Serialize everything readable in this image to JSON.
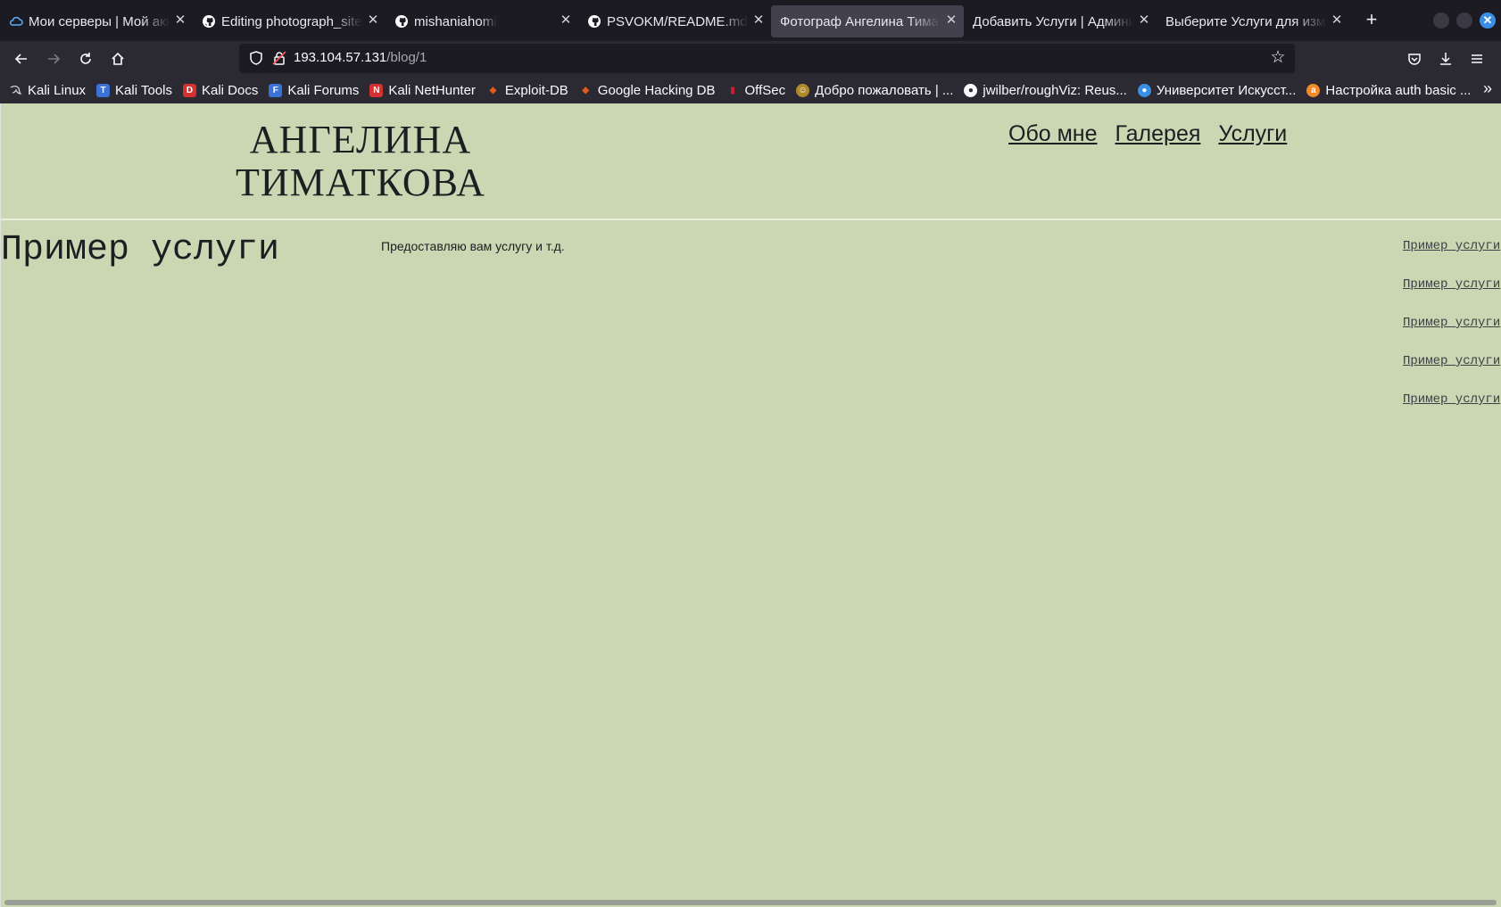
{
  "browser": {
    "tabs": [
      {
        "title": "Мои серверы | Мой аккаунт",
        "icon": "cloud-icon",
        "active": false
      },
      {
        "title": "Editing photograph_site/",
        "icon": "github-icon",
        "active": false
      },
      {
        "title": "mishaniahomi",
        "icon": "github-icon",
        "active": false
      },
      {
        "title": "PSVOKM/README.md at",
        "icon": "github-icon",
        "active": false
      },
      {
        "title": "Фотограф Ангелина Тиматкова",
        "icon": "",
        "active": true
      },
      {
        "title": "Добавить Услуги | Администрирование",
        "icon": "",
        "active": false
      },
      {
        "title": "Выберите Услуги для изменения",
        "icon": "",
        "active": false
      }
    ],
    "url": {
      "host": "193.104.57.131",
      "path": "/blog/1"
    },
    "bookmarks": [
      {
        "label": "Kali Linux",
        "icon": "kali-dragon-icon",
        "color": "#2a2a2a"
      },
      {
        "label": "Kali Tools",
        "icon": "kali-tools-icon",
        "color": "#3a72d8"
      },
      {
        "label": "Kali Docs",
        "icon": "kali-docs-icon",
        "color": "#d63131"
      },
      {
        "label": "Kali Forums",
        "icon": "kali-forums-icon",
        "color": "#3a72d8"
      },
      {
        "label": "Kali NetHunter",
        "icon": "nethunter-icon",
        "color": "#d63131"
      },
      {
        "label": "Exploit-DB",
        "icon": "exploit-db-icon",
        "color": "#e25b1a"
      },
      {
        "label": "Google Hacking DB",
        "icon": "ghdb-icon",
        "color": "#e25b1a"
      },
      {
        "label": "OffSec",
        "icon": "offsec-icon",
        "color": "#c41e2f"
      },
      {
        "label": "Добро пожаловать | ...",
        "icon": "welcome-icon",
        "color": "#b08a2a"
      },
      {
        "label": "jwilber/roughViz: Reus...",
        "icon": "github-icon",
        "color": "#2b2a33"
      },
      {
        "label": "Университет Искусст...",
        "icon": "university-icon",
        "color": "#3a8ee6"
      },
      {
        "label": "Настройка auth basic ...",
        "icon": "auth-icon",
        "color": "#f08a2a"
      }
    ]
  },
  "site": {
    "title_line1": "АНГЕЛИНА",
    "title_line2": "ТИМАТКОВА",
    "nav": {
      "about": "Обо мне",
      "gallery": "Галерея",
      "services": "Услуги"
    }
  },
  "post": {
    "title": "Пример услуги",
    "text": "Предоставляю вам услугу и т.д."
  },
  "sidebar": {
    "links": [
      "Пример услуги",
      "Пример услуги",
      "Пример услуги",
      "Пример услуги",
      "Пример услуги"
    ]
  }
}
